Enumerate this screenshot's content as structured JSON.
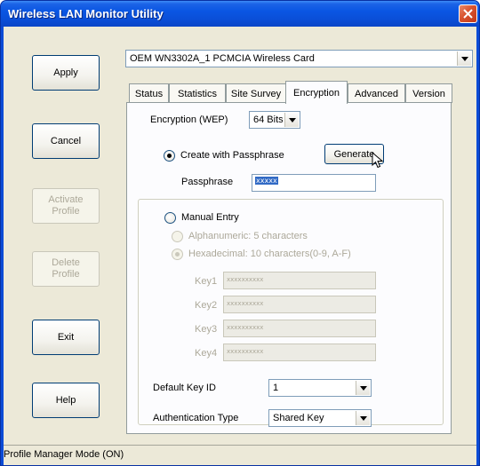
{
  "window": {
    "title": "Wireless LAN Monitor Utility"
  },
  "side_buttons": {
    "apply": "Apply",
    "cancel": "Cancel",
    "activate_profile": "Activate\nProfile",
    "delete_profile": "Delete\nProfile",
    "exit": "Exit",
    "help": "Help"
  },
  "adapter": {
    "selected": "OEM WN3302A_1 PCMCIA Wireless Card"
  },
  "tabs": [
    {
      "label": "Status"
    },
    {
      "label": "Statistics"
    },
    {
      "label": "Site Survey"
    },
    {
      "label": "Encryption",
      "active": true
    },
    {
      "label": "Advanced"
    },
    {
      "label": "Version"
    }
  ],
  "encryption": {
    "wep_label": "Encryption (WEP)",
    "wep_value": "64 Bits",
    "create_passphrase_label": "Create with Passphrase",
    "generate_label": "Generate",
    "passphrase_label": "Passphrase",
    "passphrase_value": "xxxxx",
    "manual_entry_label": "Manual Entry",
    "alphanumeric_label": "Alphanumeric: 5 characters",
    "hexadecimal_label": "Hexadecimal: 10 characters(0-9, A-F)",
    "keys": [
      {
        "label": "Key1",
        "value": "xxxxxxxxxx"
      },
      {
        "label": "Key2",
        "value": "xxxxxxxxxx"
      },
      {
        "label": "Key3",
        "value": "xxxxxxxxxx"
      },
      {
        "label": "Key4",
        "value": "xxxxxxxxxx"
      }
    ],
    "default_key_label": "Default Key ID",
    "default_key_value": "1",
    "auth_label": "Authentication Type",
    "auth_value": "Shared Key"
  },
  "status": {
    "text": "Profile Manager Mode (ON)"
  },
  "colors": {
    "title_bar": "#0a56e3",
    "dialog_bg": "#ece9d8",
    "selection": "#316ac5"
  }
}
